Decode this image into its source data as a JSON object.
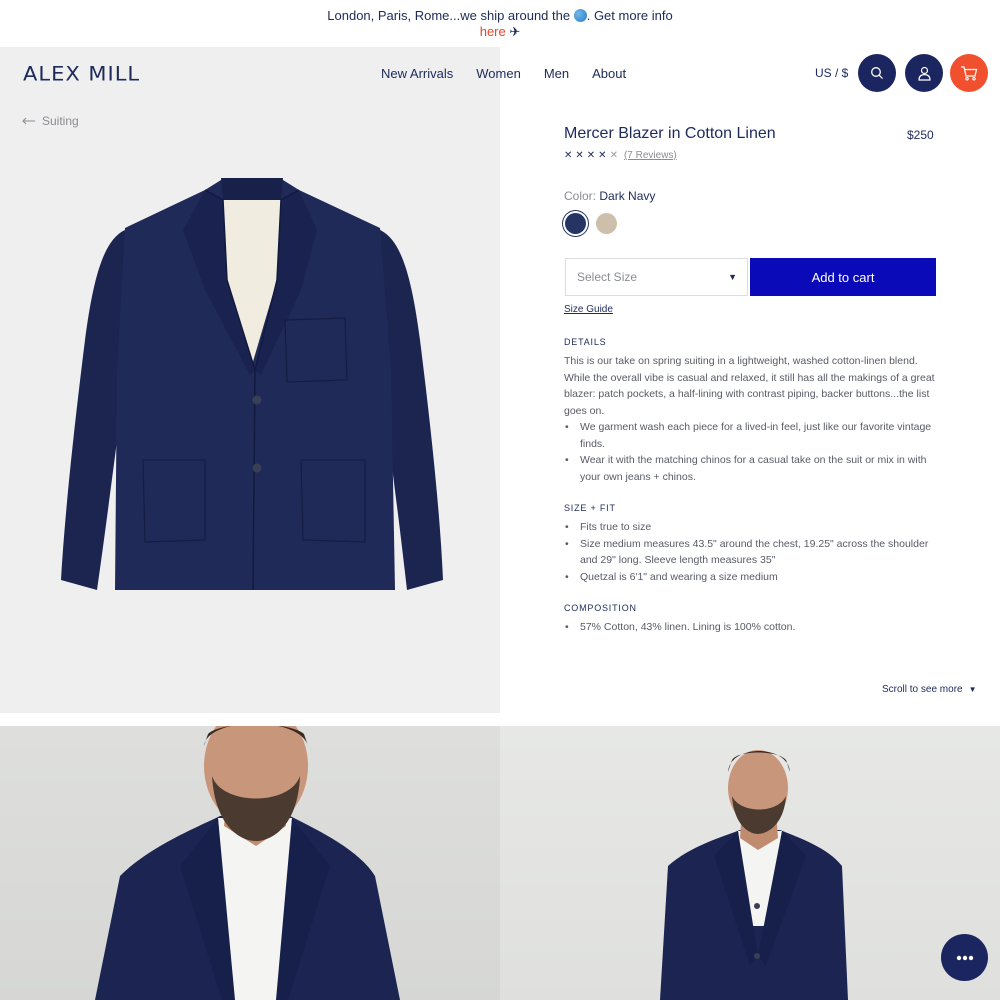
{
  "announcement": {
    "text": "London, Paris, Rome...we ship around the",
    "text_after": ". Get more info",
    "link": "here",
    "plane": "✈"
  },
  "header": {
    "logo": "ALEX MILL",
    "nav": [
      "New Arrivals",
      "Women",
      "Men",
      "About"
    ],
    "locale": "US / $",
    "icons": [
      "search-icon",
      "account-icon",
      "cart-icon"
    ],
    "accent_colors": {
      "navy": "#1b2560",
      "cart": "#f0502e"
    }
  },
  "breadcrumb": {
    "label": "Suiting"
  },
  "product": {
    "title": "Mercer Blazer in Cotton Linen",
    "price": "$250",
    "rating": 4,
    "rating_max": 5,
    "reviews": "(7 Reviews)",
    "color_label": "Color:",
    "color_value": "Dark Navy",
    "swatches": [
      {
        "name": "Dark Navy",
        "color": "#243563",
        "selected": true
      },
      {
        "name": "Tan",
        "color": "#cdbfaa",
        "selected": false
      }
    ],
    "size_placeholder": "Select Size",
    "add_to_cart": "Add to cart",
    "add_to_cart_color": "#0a0ab8",
    "size_guide": "Size Guide"
  },
  "details": {
    "heading": "DETAILS",
    "paragraph": "This is our take on spring suiting in a lightweight, washed cotton-linen blend. While the overall vibe is casual and relaxed, it still has all the makings of a great blazer: patch pockets, a half-lining with contrast piping, backer buttons...the list goes on.",
    "bullets": [
      "We garment wash each piece for a lived-in feel, just like our favorite vintage finds.",
      "Wear it with the matching chinos for a casual take on the suit or mix in with your own jeans + chinos."
    ]
  },
  "size_fit": {
    "heading": "SIZE + FIT",
    "bullets": [
      "Fits true to size",
      "Size medium measures 43.5\" around the chest, 19.25\" across the shoulder and 29\" long. Sleeve length measures 35\"",
      "Quetzal is 6'1\" and wearing a size medium"
    ]
  },
  "composition": {
    "heading": "COMPOSITION",
    "bullets": [
      "57% Cotton, 43% linen. Lining is 100% cotton."
    ]
  },
  "scroll_more": {
    "label": "Scroll to see more",
    "arrow": "▼"
  }
}
